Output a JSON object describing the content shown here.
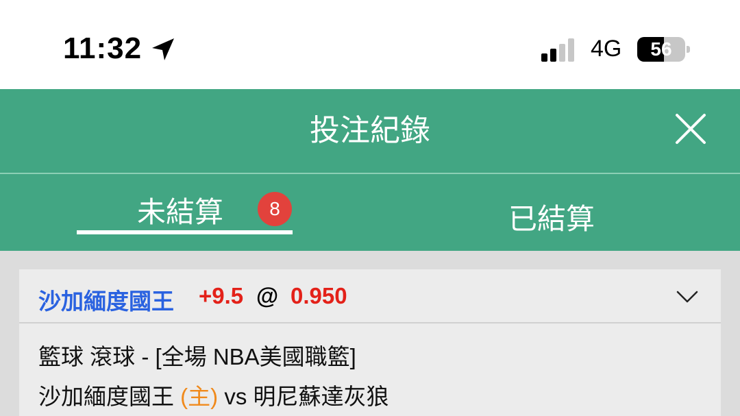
{
  "status_bar": {
    "time": "11:32",
    "network": "4G",
    "battery_level": "56",
    "battery_fraction": 0.56,
    "signal_bars_active": 2,
    "icons": [
      "location-arrow-icon",
      "signal-icon",
      "battery-icon"
    ]
  },
  "header": {
    "title": "投注紀錄",
    "close_icon": "close-icon"
  },
  "tabs": {
    "unsettled": {
      "label": "未結算",
      "badge": "8"
    },
    "settled": {
      "label": "已結算"
    }
  },
  "bet": {
    "team": "沙加緬度國王",
    "handicap": "+9.5",
    "at": "@",
    "odds": "0.950",
    "sport_line": "籃球 滾球 - [全場 NBA美國職籃]",
    "home_team": "沙加緬度國王",
    "home_marker": "(主)",
    "vs": "vs",
    "away_team": "明尼蘇達灰狼",
    "expand_icon": "chevron-down-icon"
  },
  "colors": {
    "header_green": "#42a683",
    "team_blue": "#2a62e0",
    "odds_red": "#e32119",
    "badge_red": "#e2423c",
    "home_orange": "#f08a1c"
  }
}
